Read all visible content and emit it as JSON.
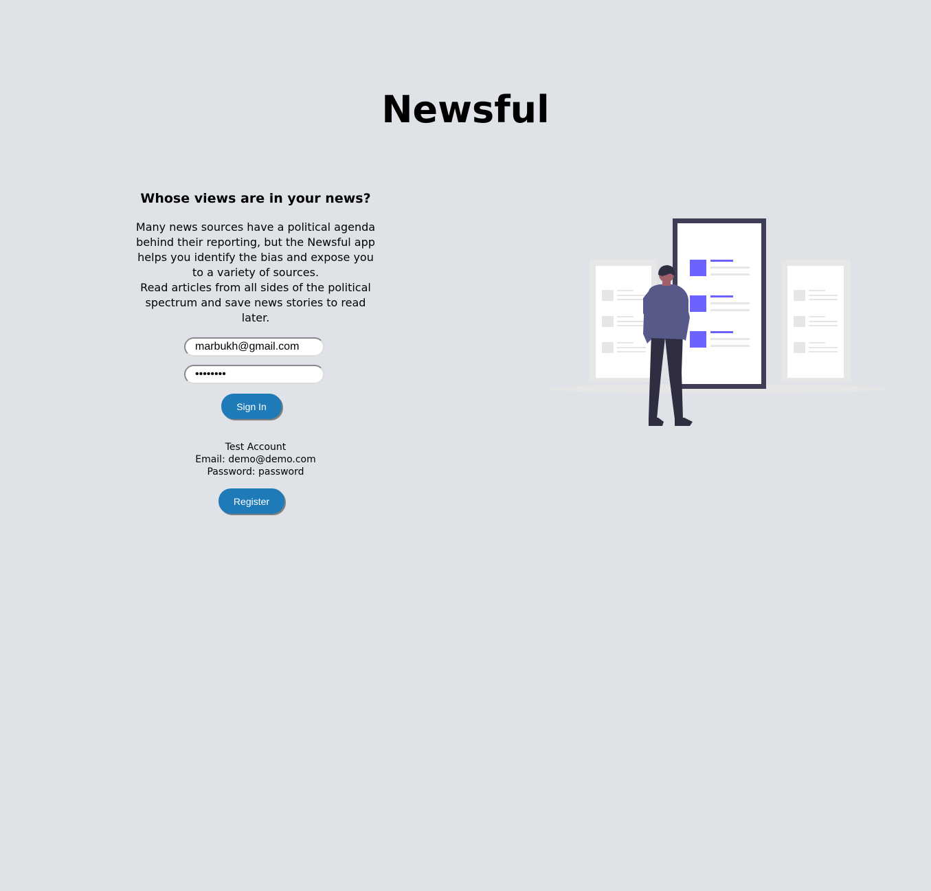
{
  "app": {
    "title": "Newsful"
  },
  "intro": {
    "headline": "Whose views are in your news?",
    "paragraph1": "Many news sources have a political agenda behind their reporting, but the Newsful app helps you identify the bias and expose you to a variety of sources.",
    "paragraph2": "Read articles from all sides of the political spectrum and save news stories to read later."
  },
  "login": {
    "email_value": "marbukh@gmail.com",
    "password_value": "password",
    "signin_label": "Sign In"
  },
  "test_account": {
    "title": "Test Account",
    "email_line": "Email: demo@demo.com",
    "password_line": "Password: password"
  },
  "register": {
    "label": "Register"
  },
  "colors": {
    "background": "#dfe3e7",
    "button": "#1f7ab8",
    "illustration_accent": "#6c63ff",
    "illustration_frame": "#3f3d56"
  }
}
